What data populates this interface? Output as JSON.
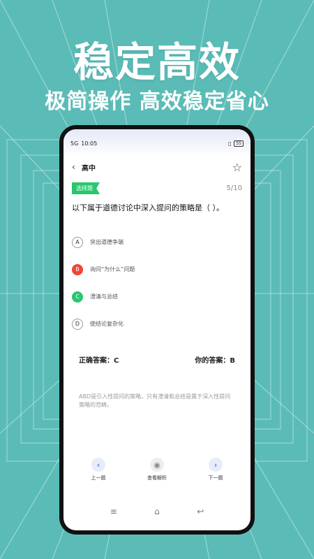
{
  "promo": {
    "headline": "稳定高效",
    "subline": "极简操作 高效稳定省心"
  },
  "statusbar": {
    "time": "10:05",
    "signal": "5G",
    "battery": "55"
  },
  "navbar": {
    "back_icon": "chevron-left-icon",
    "title": "高中",
    "star_icon": "star-outline-icon"
  },
  "question": {
    "tag": "选择题",
    "progress": "5/10",
    "text": "以下属于道德讨论中深入提问的策略是（ ）。",
    "options": [
      {
        "letter": "A",
        "text": "突出道德争端",
        "state": "normal"
      },
      {
        "letter": "B",
        "text": "询问“为什么”问题",
        "state": "wrong"
      },
      {
        "letter": "C",
        "text": "澄清与总结",
        "state": "right"
      },
      {
        "letter": "D",
        "text": "使结论复杂化",
        "state": "normal"
      }
    ]
  },
  "answers": {
    "correct": "正确答案：C",
    "mine": "你的答案：B"
  },
  "analysis": "ABD是引入性提问的策略，只有澄清和总结是属于深入性提问策略的范畴。",
  "actions": {
    "prev": "上一题",
    "view": "查看解析",
    "next": "下一题"
  },
  "colors": {
    "background": "#5bbcb7",
    "correct": "#28c76f",
    "wrong": "#f04438",
    "accent": "#4a78e0"
  }
}
